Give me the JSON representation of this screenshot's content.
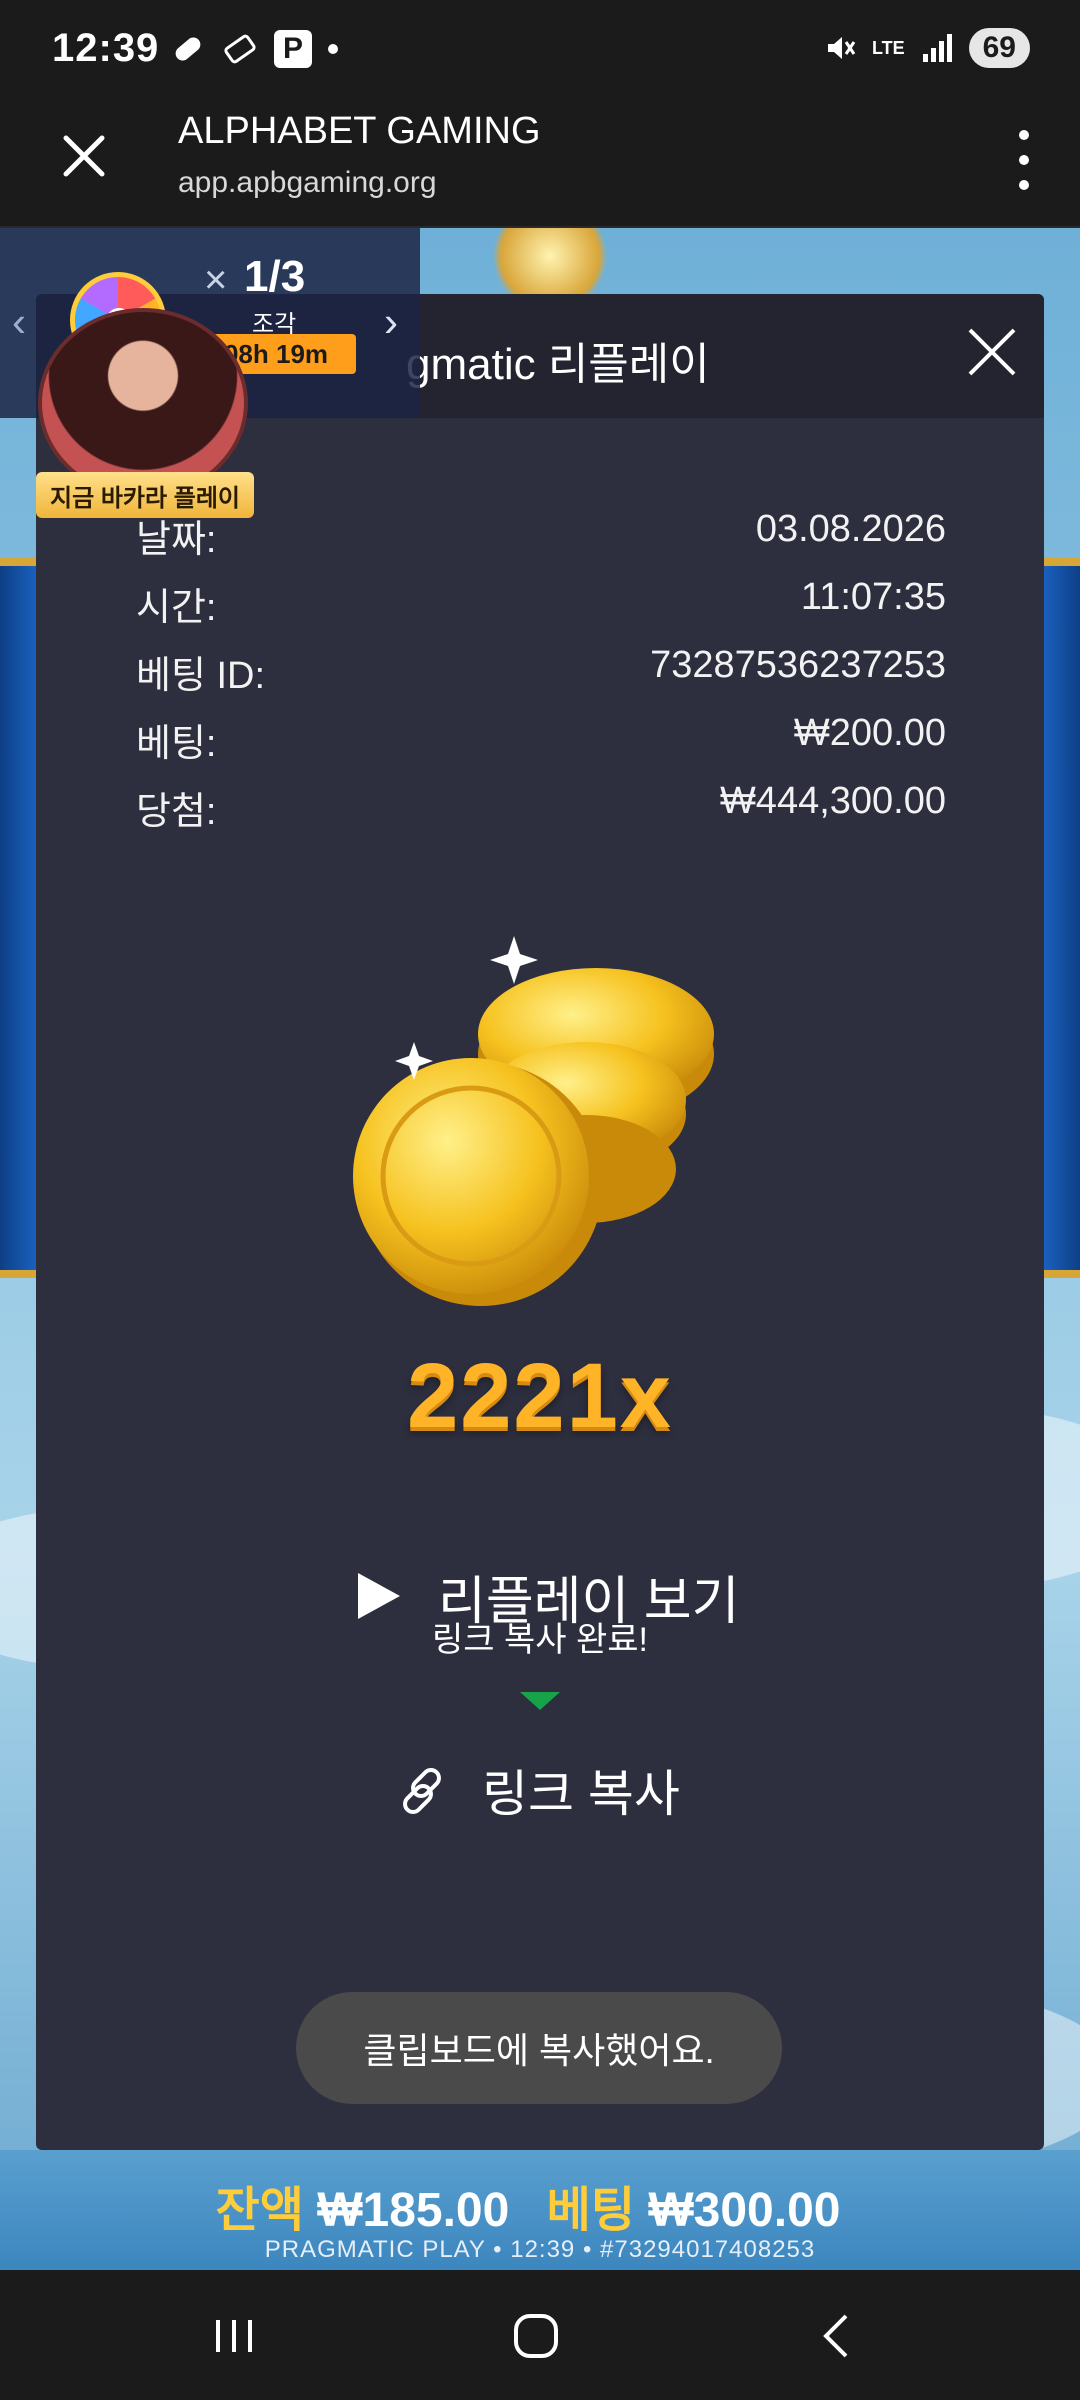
{
  "status_bar": {
    "time": "12:39",
    "network": "LTE",
    "battery": "69",
    "icons_left": [
      "pill-icon",
      "ticket-icon",
      "parking-p-icon",
      "notification-dot-icon"
    ],
    "icons_right": [
      "mute-icon",
      "lte-icon",
      "signal-icon",
      "battery-icon"
    ]
  },
  "browser": {
    "title": "ALPHABET GAMING",
    "url": "app.apbgaming.org"
  },
  "promo": {
    "count": "1/3",
    "sub": "조각",
    "timer": "08h 19m",
    "avatar_label": "지금 바카라 플레이"
  },
  "modal": {
    "title": "gmatic 리플레이",
    "rows": [
      {
        "label": "날짜:",
        "value": "03.08.2026"
      },
      {
        "label": "시간:",
        "value": "11:07:35"
      },
      {
        "label": "베팅 ID:",
        "value": "73287536237253"
      },
      {
        "label": "베팅:",
        "value": "₩200.00"
      },
      {
        "label": "당첨:",
        "value": "₩444,300.00"
      }
    ],
    "multiplier": "2221x",
    "replay_label": "리플레이 보기",
    "tooltip": "링크 복사 완료!",
    "copy_label": "링크 복사",
    "toast": "클립보드에 복사했어요."
  },
  "game_footer": {
    "balance_label": "잔액",
    "balance_value": "₩185.00",
    "bet_label": "베팅",
    "bet_value": "₩300.00",
    "meta": "PRAGMATIC PLAY • 12:39 • #73294017408253"
  },
  "colors": {
    "modal_bg": "#2d2e3e",
    "header_bg": "#23242f",
    "multiplier": "#ffb327",
    "accent_green": "#16a34a",
    "timer_orange": "#ff9e1b"
  }
}
